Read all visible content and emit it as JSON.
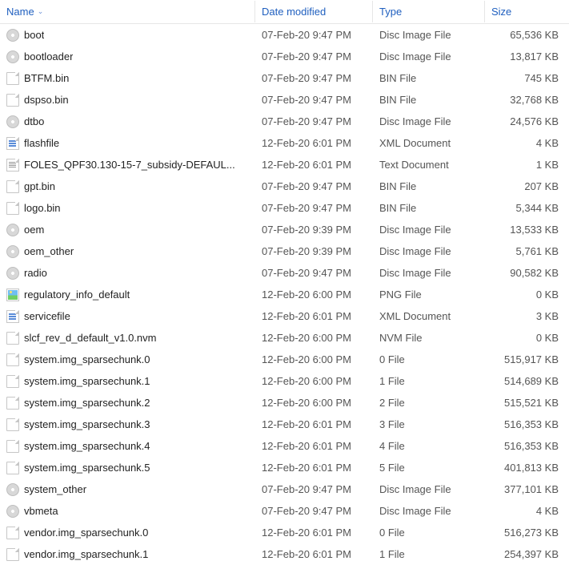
{
  "columns": {
    "name": "Name",
    "date": "Date modified",
    "type": "Type",
    "size": "Size"
  },
  "files": [
    {
      "icon": "disc",
      "name": "boot",
      "date": "07-Feb-20 9:47 PM",
      "type": "Disc Image File",
      "size": "65,536 KB"
    },
    {
      "icon": "disc",
      "name": "bootloader",
      "date": "07-Feb-20 9:47 PM",
      "type": "Disc Image File",
      "size": "13,817 KB"
    },
    {
      "icon": "file",
      "name": "BTFM.bin",
      "date": "07-Feb-20 9:47 PM",
      "type": "BIN File",
      "size": "745 KB"
    },
    {
      "icon": "file",
      "name": "dspso.bin",
      "date": "07-Feb-20 9:47 PM",
      "type": "BIN File",
      "size": "32,768 KB"
    },
    {
      "icon": "disc",
      "name": "dtbo",
      "date": "07-Feb-20 9:47 PM",
      "type": "Disc Image File",
      "size": "24,576 KB"
    },
    {
      "icon": "xml",
      "name": "flashfile",
      "date": "12-Feb-20 6:01 PM",
      "type": "XML Document",
      "size": "4 KB"
    },
    {
      "icon": "txt",
      "name": "FOLES_QPF30.130-15-7_subsidy-DEFAUL...",
      "date": "12-Feb-20 6:01 PM",
      "type": "Text Document",
      "size": "1 KB"
    },
    {
      "icon": "file",
      "name": "gpt.bin",
      "date": "07-Feb-20 9:47 PM",
      "type": "BIN File",
      "size": "207 KB"
    },
    {
      "icon": "file",
      "name": "logo.bin",
      "date": "07-Feb-20 9:47 PM",
      "type": "BIN File",
      "size": "5,344 KB"
    },
    {
      "icon": "disc",
      "name": "oem",
      "date": "07-Feb-20 9:39 PM",
      "type": "Disc Image File",
      "size": "13,533 KB"
    },
    {
      "icon": "disc",
      "name": "oem_other",
      "date": "07-Feb-20 9:39 PM",
      "type": "Disc Image File",
      "size": "5,761 KB"
    },
    {
      "icon": "disc",
      "name": "radio",
      "date": "07-Feb-20 9:47 PM",
      "type": "Disc Image File",
      "size": "90,582 KB"
    },
    {
      "icon": "png",
      "name": "regulatory_info_default",
      "date": "12-Feb-20 6:00 PM",
      "type": "PNG File",
      "size": "0 KB"
    },
    {
      "icon": "xml",
      "name": "servicefile",
      "date": "12-Feb-20 6:01 PM",
      "type": "XML Document",
      "size": "3 KB"
    },
    {
      "icon": "file",
      "name": "slcf_rev_d_default_v1.0.nvm",
      "date": "12-Feb-20 6:00 PM",
      "type": "NVM File",
      "size": "0 KB"
    },
    {
      "icon": "file",
      "name": "system.img_sparsechunk.0",
      "date": "12-Feb-20 6:00 PM",
      "type": "0 File",
      "size": "515,917 KB"
    },
    {
      "icon": "file",
      "name": "system.img_sparsechunk.1",
      "date": "12-Feb-20 6:00 PM",
      "type": "1 File",
      "size": "514,689 KB"
    },
    {
      "icon": "file",
      "name": "system.img_sparsechunk.2",
      "date": "12-Feb-20 6:00 PM",
      "type": "2 File",
      "size": "515,521 KB"
    },
    {
      "icon": "file",
      "name": "system.img_sparsechunk.3",
      "date": "12-Feb-20 6:01 PM",
      "type": "3 File",
      "size": "516,353 KB"
    },
    {
      "icon": "file",
      "name": "system.img_sparsechunk.4",
      "date": "12-Feb-20 6:01 PM",
      "type": "4 File",
      "size": "516,353 KB"
    },
    {
      "icon": "file",
      "name": "system.img_sparsechunk.5",
      "date": "12-Feb-20 6:01 PM",
      "type": "5 File",
      "size": "401,813 KB"
    },
    {
      "icon": "disc",
      "name": "system_other",
      "date": "07-Feb-20 9:47 PM",
      "type": "Disc Image File",
      "size": "377,101 KB"
    },
    {
      "icon": "disc",
      "name": "vbmeta",
      "date": "07-Feb-20 9:47 PM",
      "type": "Disc Image File",
      "size": "4 KB"
    },
    {
      "icon": "file",
      "name": "vendor.img_sparsechunk.0",
      "date": "12-Feb-20 6:01 PM",
      "type": "0 File",
      "size": "516,273 KB"
    },
    {
      "icon": "file",
      "name": "vendor.img_sparsechunk.1",
      "date": "12-Feb-20 6:01 PM",
      "type": "1 File",
      "size": "254,397 KB"
    }
  ]
}
